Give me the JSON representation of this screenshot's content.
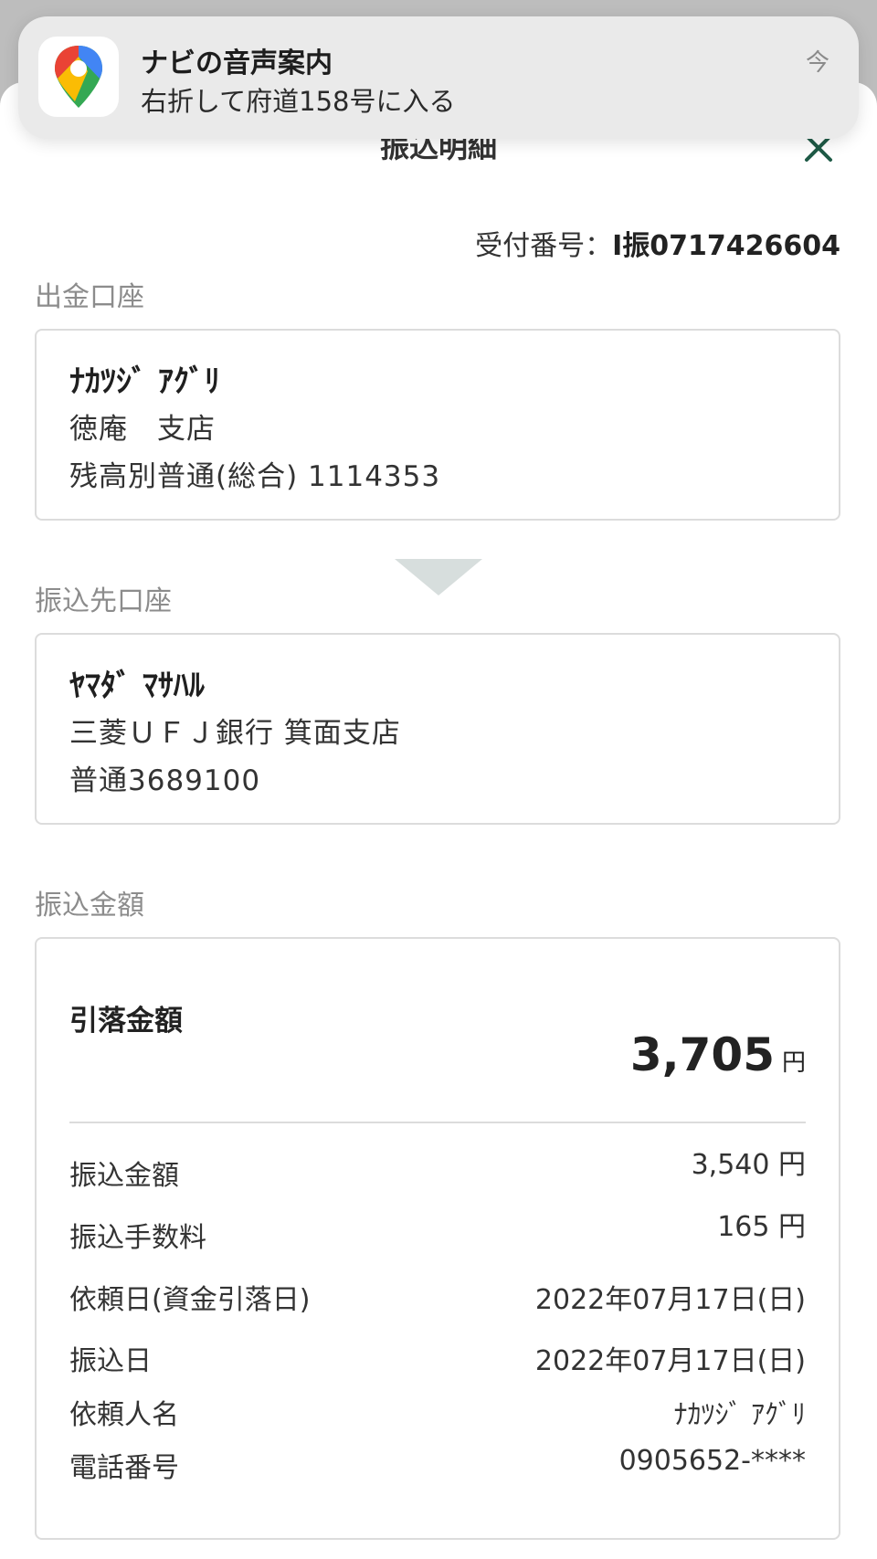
{
  "notification": {
    "app_icon": "google-maps-icon",
    "title": "ナビの音声案内",
    "body": "右折して府道158号に入る",
    "time": "今"
  },
  "header": {
    "title": "振込明細",
    "close_icon": "close-icon"
  },
  "receipt": {
    "label": "受付番号：",
    "number": "I振0717426604"
  },
  "source_account": {
    "section_label": "出金口座",
    "name": "ﾅｶﾂｼﾞ ｱｸﾞﾘ",
    "branch": "徳庵　支店",
    "account": "残高別普通(総合) 1114353"
  },
  "destination_account": {
    "section_label": "振込先口座",
    "name": "ﾔﾏﾀﾞ ﾏｻﾊﾙ",
    "bank": "三菱ＵＦＪ銀行 箕面支店",
    "account": "普通3689100"
  },
  "amount": {
    "section_label": "振込金額",
    "total_label": "引落金額",
    "total_value": "3,705",
    "total_unit": "円",
    "rows": [
      {
        "label": "振込金額",
        "value": "3,540 円"
      },
      {
        "label": "振込手数料",
        "value": "165 円"
      },
      {
        "label": "依頼日(資金引落日)",
        "value": "2022年07月17日(日)"
      },
      {
        "label": "振込日",
        "value": "2022年07月17日(日)"
      },
      {
        "label": "依頼人名",
        "value": "ﾅｶﾂｼﾞ ｱｸﾞﾘ"
      },
      {
        "label": "電話番号",
        "value": "0905652-****"
      }
    ]
  },
  "colors": {
    "accent": "#1e5a46",
    "label_gray": "#8c8c8c",
    "border": "#dcdcdc"
  }
}
